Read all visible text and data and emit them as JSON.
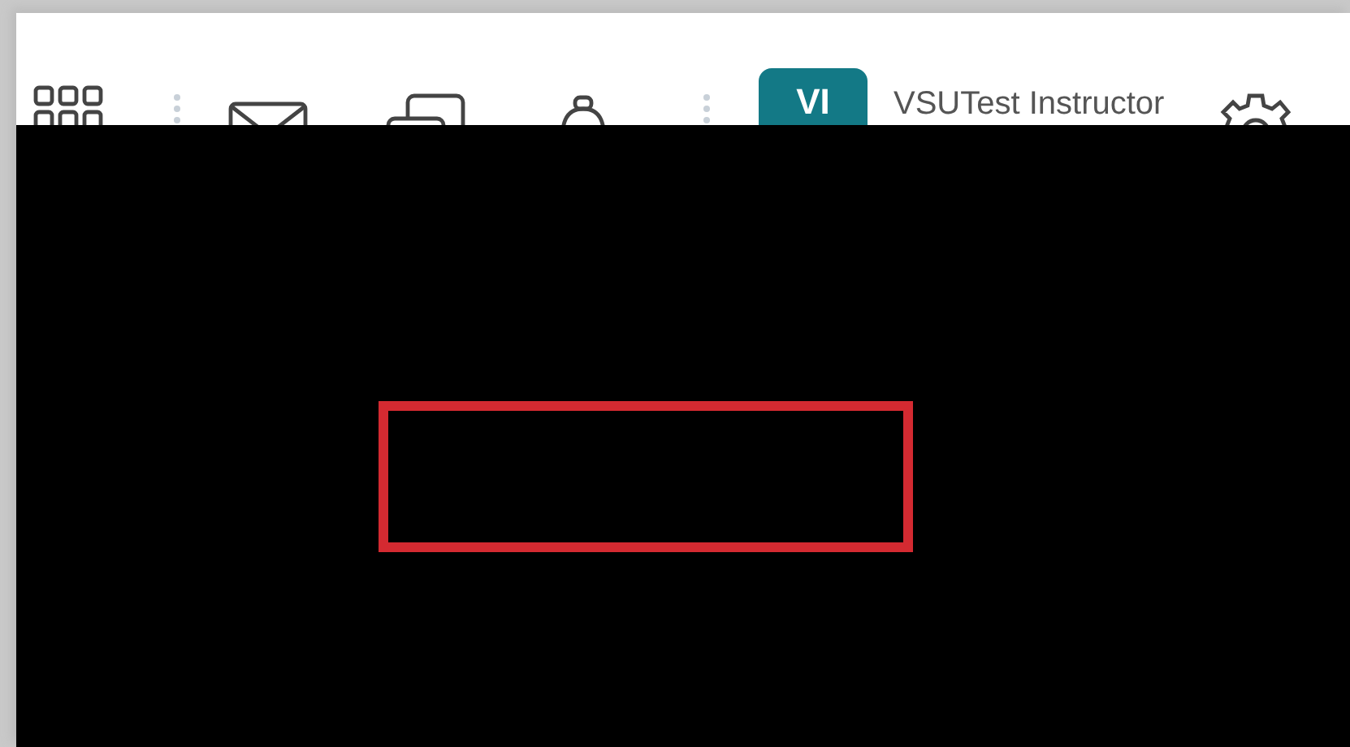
{
  "navbar": {
    "avatar": {
      "initials": "VI"
    },
    "user_name": "VSUTest Instructor"
  },
  "overlay": {
    "highlight": {
      "color": "#d42a31"
    }
  }
}
